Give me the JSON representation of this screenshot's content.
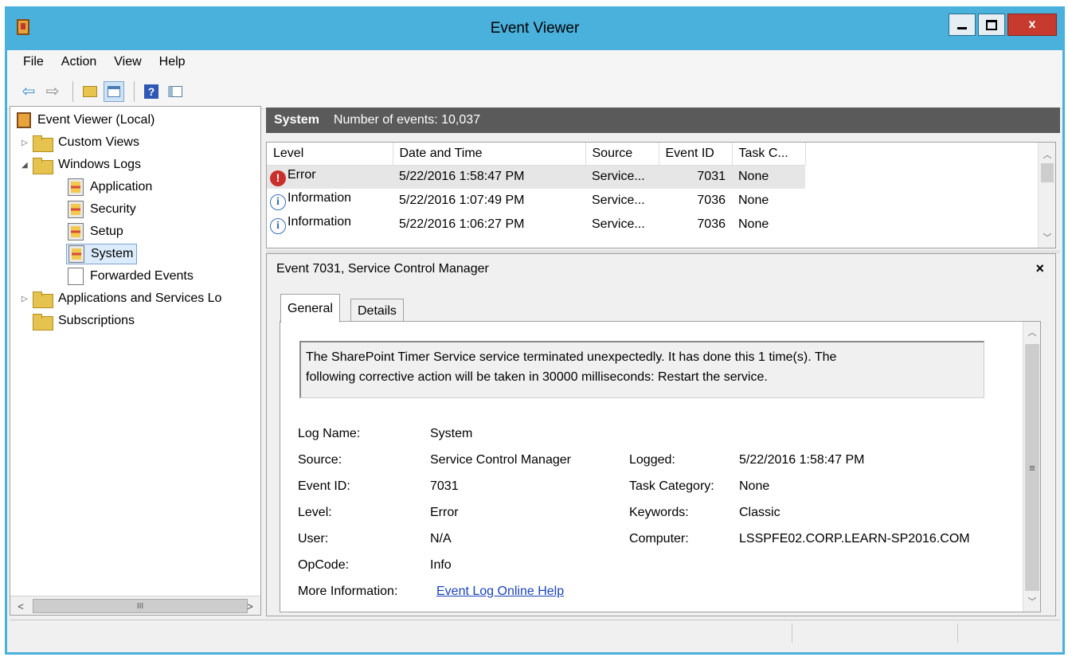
{
  "window": {
    "title": "Event Viewer"
  },
  "menu": [
    "File",
    "Action",
    "View",
    "Help"
  ],
  "toolbar": {
    "back_glyph": "⇦",
    "forward_glyph": "⇨",
    "help_glyph": "?"
  },
  "tree": {
    "root": "Event Viewer (Local)",
    "custom_views": "Custom Views",
    "windows_logs": "Windows Logs",
    "application": "Application",
    "security": "Security",
    "setup": "Setup",
    "system": "System",
    "forwarded": "Forwarded Events",
    "apps_services": "Applications and Services Lo",
    "subscriptions": "Subscriptions",
    "scroll_left": "<",
    "scroll_right": ">",
    "scroll_grip": "III"
  },
  "log_header": {
    "name": "System",
    "count_text": "Number of events: 10,037"
  },
  "events": {
    "columns": [
      "Level",
      "Date and Time",
      "Source",
      "Event ID",
      "Task C..."
    ],
    "rows": [
      {
        "level": "Error",
        "date": "5/22/2016 1:58:47 PM",
        "source": "Service...",
        "id": "7031",
        "task": "None"
      },
      {
        "level": "Information",
        "date": "5/22/2016 1:07:49 PM",
        "source": "Service...",
        "id": "7036",
        "task": "None"
      },
      {
        "level": "Information",
        "date": "5/22/2016 1:06:27 PM",
        "source": "Service...",
        "id": "7036",
        "task": "None"
      }
    ]
  },
  "detail": {
    "title": "Event 7031, Service Control Manager",
    "close": "×",
    "tabs": [
      "General",
      "Details"
    ],
    "message_line1": "The SharePoint Timer Service service terminated unexpectedly.  It has done this 1 time(s).  The",
    "message_line2": "following corrective action will be taken in 30000 milliseconds: Restart the service.",
    "labels": {
      "log_name": "Log Name:",
      "source": "Source:",
      "event_id": "Event ID:",
      "level": "Level:",
      "user": "User:",
      "opcode": "OpCode:",
      "more_info": "More Information:",
      "logged": "Logged:",
      "task_category": "Task Category:",
      "keywords": "Keywords:",
      "computer": "Computer:"
    },
    "values": {
      "log_name": "System",
      "source": "Service Control Manager",
      "event_id": "7031",
      "level": "Error",
      "user": "N/A",
      "opcode": "Info",
      "more_info": "Event Log Online Help",
      "logged": "5/22/2016 1:58:47 PM",
      "task_category": "None",
      "keywords": "Classic",
      "computer": "LSSPFE02.CORP.LEARN-SP2016.COM"
    }
  }
}
